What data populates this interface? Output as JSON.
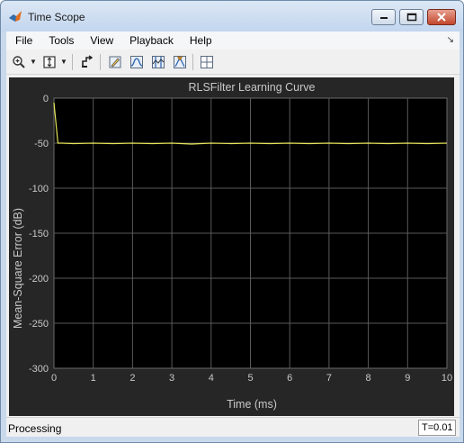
{
  "window": {
    "title": "Time Scope"
  },
  "menubar": {
    "items": [
      "File",
      "Tools",
      "View",
      "Playback",
      "Help"
    ]
  },
  "toolbar": {
    "buttons": [
      "zoom-in-icon",
      "zoom-fit-icon",
      "restore-icon",
      "edit-config-icon",
      "triggers-icon",
      "cursor-measurements-icon",
      "peak-finder-icon",
      "layout-icon"
    ]
  },
  "status": {
    "text": "Processing",
    "time": "T=0.01"
  },
  "chart_data": {
    "type": "line",
    "title": "RLSFilter Learning Curve",
    "xlabel": "Time (ms)",
    "ylabel": "Mean-Square Error (dB)",
    "xlim": [
      0,
      10
    ],
    "ylim": [
      -300,
      0
    ],
    "xticks": [
      "0",
      "1",
      "2",
      "3",
      "4",
      "5",
      "6",
      "7",
      "8",
      "9",
      "10"
    ],
    "yticks": [
      "0",
      "-50",
      "-100",
      "-150",
      "-200",
      "-250",
      "-300"
    ],
    "grid": true,
    "colors": {
      "line": "#e6e65a",
      "background": "#000000",
      "frame": "#262626",
      "text": "#c8c8c8"
    },
    "series": [
      {
        "x": [
          0,
          0.1,
          0.2,
          0.5,
          1,
          1.5,
          2,
          2.5,
          3,
          3.5,
          4,
          4.5,
          5,
          5.5,
          6,
          6.5,
          7,
          7.5,
          8,
          8.5,
          9,
          9.5,
          10
        ],
        "values": [
          -5,
          -50,
          -50,
          -50.5,
          -50,
          -50.5,
          -50,
          -50.5,
          -50,
          -51,
          -50,
          -50.5,
          -50,
          -50.5,
          -50,
          -50.5,
          -50,
          -50.5,
          -50,
          -50.5,
          -50,
          -50.5,
          -50
        ]
      }
    ]
  }
}
